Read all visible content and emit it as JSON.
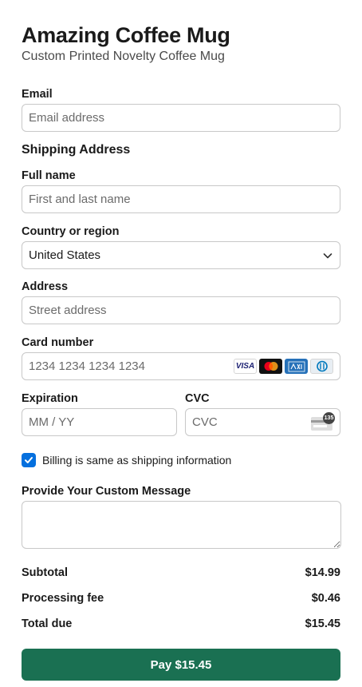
{
  "product": {
    "title": "Amazing Coffee Mug",
    "subtitle": "Custom Printed Novelty Coffee Mug"
  },
  "email": {
    "label": "Email",
    "placeholder": "Email address"
  },
  "shipping": {
    "section_title": "Shipping Address",
    "full_name_label": "Full name",
    "full_name_placeholder": "First and last name",
    "country_label": "Country or region",
    "country_value": "United States",
    "address_label": "Address",
    "address_placeholder": "Street address"
  },
  "card": {
    "number_label": "Card number",
    "number_placeholder": "1234 1234 1234 1234",
    "brands": [
      "visa-icon",
      "mastercard-icon",
      "amex-icon",
      "diners-icon"
    ],
    "visa_text": "VISA",
    "expiration_label": "Expiration",
    "expiration_placeholder": "MM / YY",
    "cvc_label": "CVC",
    "cvc_placeholder": "CVC",
    "cvc_icon_text": "135"
  },
  "billing": {
    "same_as_shipping_label": "Billing is same as shipping information",
    "checked": true
  },
  "custom_message": {
    "label": "Provide Your Custom Message",
    "value": ""
  },
  "summary": {
    "subtotal_label": "Subtotal",
    "subtotal_value": "$14.99",
    "fee_label": "Processing fee",
    "fee_value": "$0.46",
    "total_label": "Total due",
    "total_value": "$15.45"
  },
  "pay_button": {
    "label": "Pay $15.45"
  },
  "colors": {
    "accent_button": "#1a7052",
    "checkbox": "#0570de"
  }
}
